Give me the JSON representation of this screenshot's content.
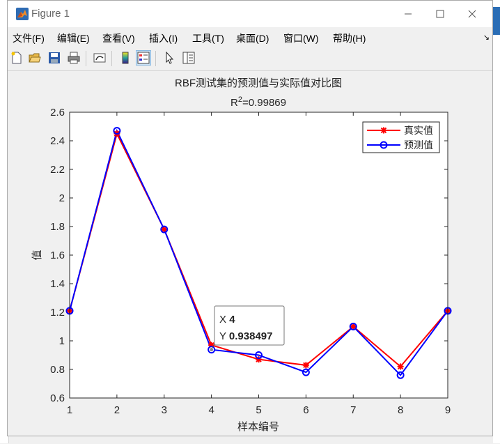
{
  "window": {
    "title": "Figure 1"
  },
  "menu": [
    "文件(F)",
    "编辑(E)",
    "查看(V)",
    "插入(I)",
    "工具(T)",
    "桌面(D)",
    "窗口(W)",
    "帮助(H)"
  ],
  "toolbar": {
    "icons": [
      "new-figure-icon",
      "open-file-icon",
      "save-icon",
      "print-icon",
      "link-plot-icon",
      "insert-colorbar-icon",
      "insert-legend-icon",
      "pointer-icon",
      "property-editor-icon"
    ]
  },
  "chart_data": {
    "type": "line",
    "title": "RBF测试集的预测值与实际值对比图",
    "subtitle_prefix": "R",
    "subtitle_sup": "2",
    "subtitle_suffix": "=0.99869",
    "xlabel": "样本编号",
    "ylabel": "值",
    "xlim": [
      1,
      9
    ],
    "ylim": [
      0.6,
      2.6
    ],
    "xticks": [
      1,
      2,
      3,
      4,
      5,
      6,
      7,
      8,
      9
    ],
    "yticks": [
      "0.6",
      "0.8",
      "1",
      "1.2",
      "1.4",
      "1.6",
      "1.8",
      "2",
      "2.2",
      "2.4",
      "2.6"
    ],
    "x": [
      1,
      2,
      3,
      4,
      5,
      6,
      7,
      8,
      9
    ],
    "series": [
      {
        "name": "真实值",
        "color": "#ff0000",
        "marker": "asterisk",
        "values": [
          1.21,
          2.45,
          1.78,
          0.97,
          0.87,
          0.83,
          1.1,
          0.82,
          1.21
        ]
      },
      {
        "name": "预测值",
        "color": "#0000ff",
        "marker": "circle",
        "values": [
          1.21,
          2.47,
          1.78,
          0.938497,
          0.9,
          0.78,
          1.1,
          0.76,
          1.21
        ]
      }
    ],
    "legend_position": "top-right",
    "datatip": {
      "x_label": "X",
      "x_value": "4",
      "y_label": "Y",
      "y_value": "0.938497"
    }
  }
}
